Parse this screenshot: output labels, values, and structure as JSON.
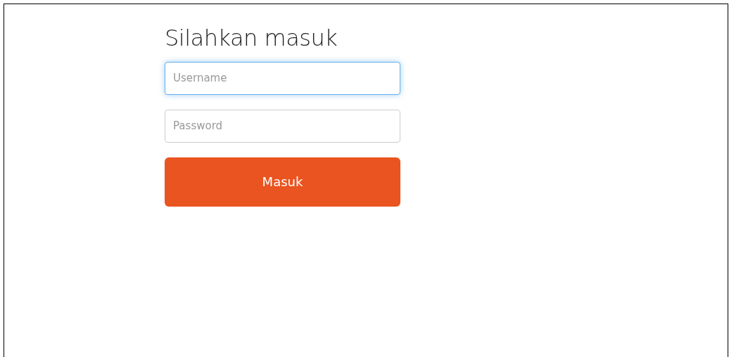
{
  "title": "Silahkan masuk",
  "fields": [
    {
      "placeholder": "Username",
      "focused": true
    },
    {
      "placeholder": "Password",
      "focused": false
    }
  ],
  "button": {
    "label": "Masuk"
  }
}
